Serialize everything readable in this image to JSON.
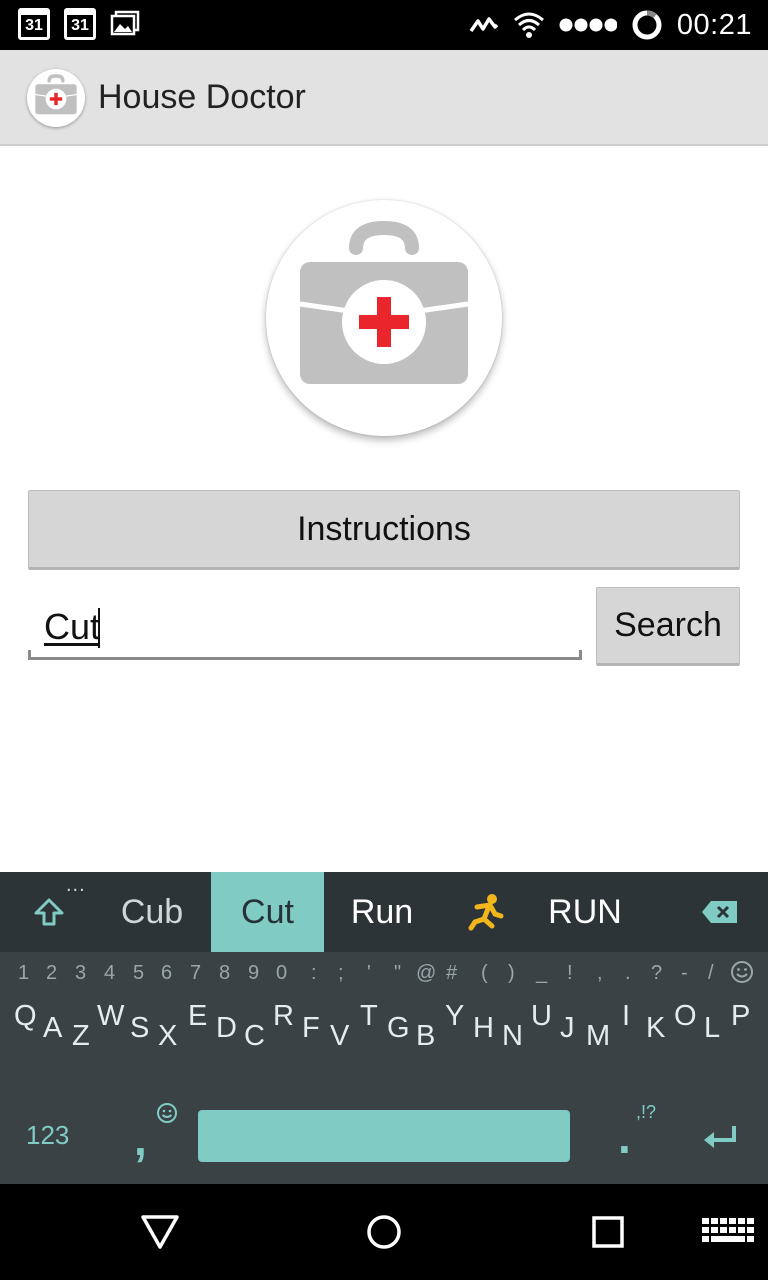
{
  "status_bar": {
    "time": "00:21",
    "notifications": [
      {
        "icon": "calendar-icon",
        "label": "31"
      },
      {
        "icon": "calendar-icon",
        "label": "31"
      },
      {
        "icon": "image-icon"
      }
    ],
    "indicators": [
      "activity-icon",
      "wifi-icon",
      "signal-dots-icon",
      "battery-ring-icon"
    ]
  },
  "app_bar": {
    "title": "House Doctor",
    "logo": "first-aid-kit-icon"
  },
  "main": {
    "logo": "first-aid-kit-icon",
    "instructions_button": "Instructions",
    "search_input_value": "Cut",
    "search_button": "Search"
  },
  "keyboard": {
    "suggestions": [
      "Cub",
      "Cut",
      "Run",
      "RUN"
    ],
    "active_suggestion": "Cut",
    "more_hint": "...",
    "number_row": [
      "1",
      "2",
      "3",
      "4",
      "5",
      "6",
      "7",
      "8",
      "9",
      "0",
      ":",
      ";",
      "'",
      "\"",
      "@",
      "#",
      "(",
      ")",
      "_",
      "!",
      ",",
      ".",
      "?",
      "-",
      "/"
    ],
    "letter_row": [
      "Q",
      "A",
      "Z",
      "W",
      "S",
      "X",
      "E",
      "D",
      "C",
      "R",
      "F",
      "V",
      "T",
      "G",
      "B",
      "Y",
      "H",
      "N",
      "U",
      "J",
      "M",
      "I",
      "K",
      "O",
      "L",
      "P"
    ],
    "mode_key": "123",
    "comma_key": ",",
    "period_key": ".",
    "punct_hint": ",!?",
    "colors": {
      "accent": "#80cbc4",
      "background": "#3a4246",
      "suggestion_bar": "#2d3438"
    }
  },
  "colors": {
    "status_bar": "#000000",
    "app_bar": "#e2e2e2",
    "button": "#d6d6d6",
    "kit_gray": "#c0c0c0",
    "cross_red": "#e8262b"
  }
}
